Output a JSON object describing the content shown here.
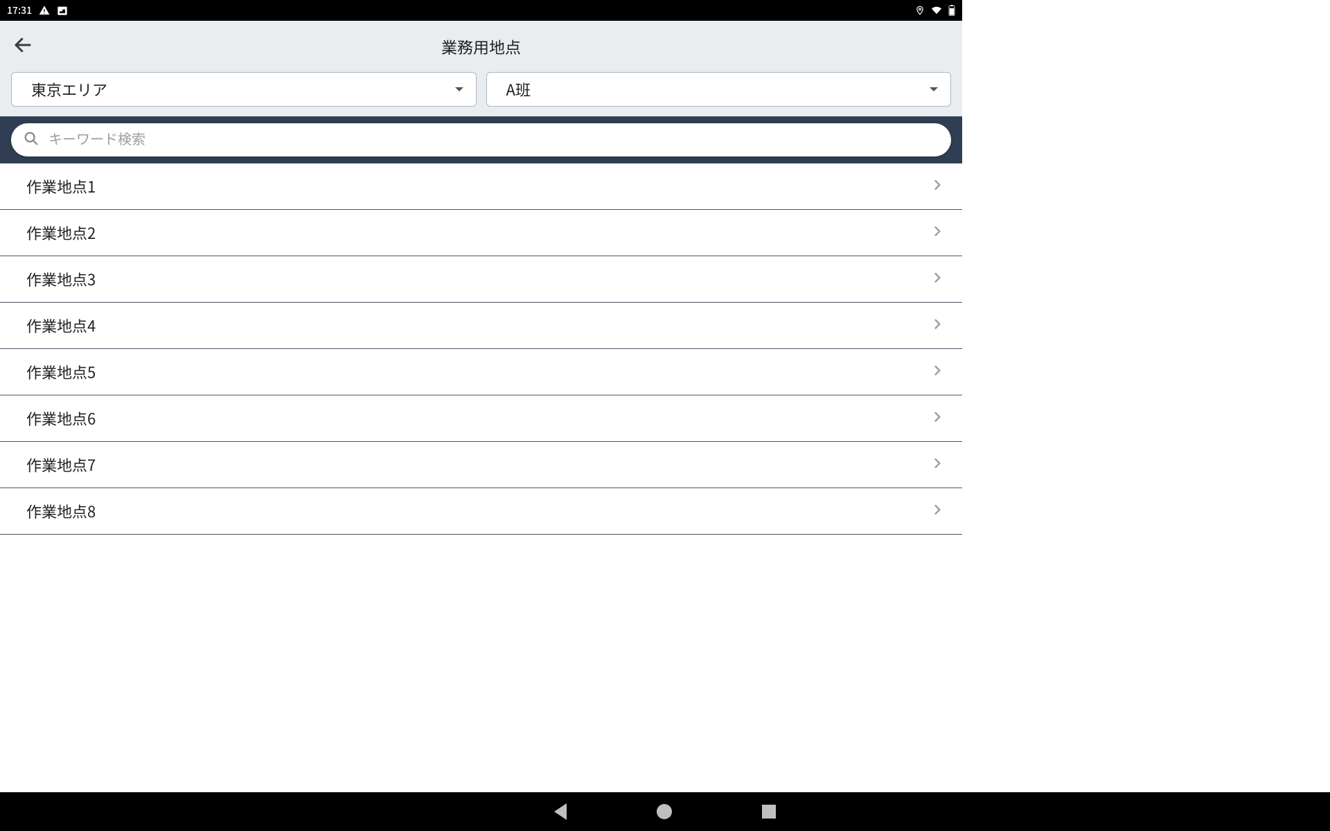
{
  "status": {
    "time": "17:31"
  },
  "header": {
    "title": "業務用地点"
  },
  "dropdowns": {
    "area": "東京エリア",
    "group": "A班"
  },
  "search": {
    "placeholder": "キーワード検索"
  },
  "list": {
    "items": [
      {
        "label": "作業地点1"
      },
      {
        "label": "作業地点2"
      },
      {
        "label": "作業地点3"
      },
      {
        "label": "作業地点4"
      },
      {
        "label": "作業地点5"
      },
      {
        "label": "作業地点6"
      },
      {
        "label": "作業地点7"
      },
      {
        "label": "作業地点8"
      }
    ]
  }
}
